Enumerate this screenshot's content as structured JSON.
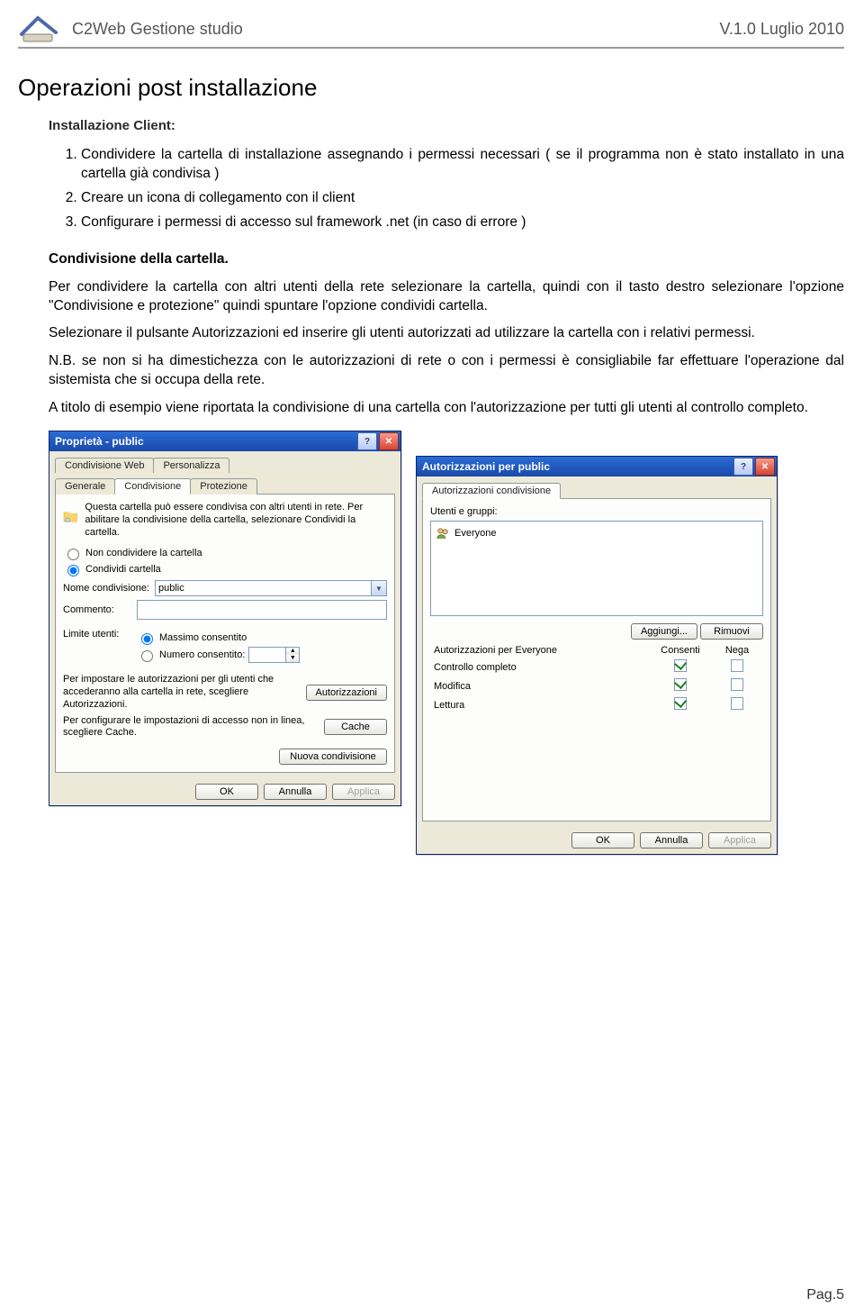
{
  "header": {
    "left": "C2Web Gestione studio",
    "right": "V.1.0 Luglio 2010"
  },
  "title": "Operazioni post installazione",
  "subhead1": "Installazione Client:",
  "steps": [
    "Condividere la cartella di installazione assegnando i permessi necessari ( se il programma non è stato installato in una cartella già condivisa )",
    "Creare un icona di collegamento con il client",
    "Configurare i permessi di accesso sul framework .net (in caso di errore )"
  ],
  "subhead2": "Condivisione della cartella.",
  "paras": [
    "Per condividere la cartella con altri utenti della rete selezionare la cartella, quindi con il tasto destro selezionare l'opzione \"Condivisione e protezione\" quindi spuntare l'opzione condividi cartella.",
    "Selezionare il pulsante Autorizzazioni ed inserire gli utenti autorizzati ad utilizzare la cartella con i relativi permessi.",
    "N.B. se non si ha dimestichezza con le autorizzazioni di rete o con i permessi è consigliabile far effettuare l'operazione dal sistemista che si occupa della rete.",
    "A titolo di esempio viene riportata la condivisione di una cartella con l'autorizzazione per tutti gli utenti al controllo completo."
  ],
  "footer": "Pag.5",
  "dlg1": {
    "title": "Proprietà - public",
    "tabs_row1": [
      "Condivisione Web",
      "Personalizza"
    ],
    "tabs_row2": [
      "Generale",
      "Condivisione",
      "Protezione"
    ],
    "active_tab": "Condivisione",
    "info": "Questa cartella può essere condivisa con altri utenti in rete. Per abilitare la condivisione della cartella, selezionare Condividi la cartella.",
    "radio_noshare": "Non condividere la cartella",
    "radio_share": "Condividi cartella",
    "share_name_label": "Nome condivisione:",
    "share_name_value": "public",
    "comment_label": "Commento:",
    "limit_label": "Limite utenti:",
    "radio_max": "Massimo consentito",
    "radio_num": "Numero consentito:",
    "perm_text": "Per impostare le autorizzazioni per gli utenti che accederanno alla cartella in rete, scegliere Autorizzazioni.",
    "cache_text": "Per configurare le impostazioni di accesso non in linea, scegliere Cache.",
    "btn_auth": "Autorizzazioni",
    "btn_cache": "Cache",
    "btn_newshare": "Nuova condivisione",
    "btn_ok": "OK",
    "btn_cancel": "Annulla",
    "btn_apply": "Applica"
  },
  "dlg2": {
    "title": "Autorizzazioni per public",
    "tab": "Autorizzazioni condivisione",
    "users_label": "Utenti e gruppi:",
    "user": "Everyone",
    "btn_add": "Aggiungi...",
    "btn_remove": "Rimuovi",
    "perm_header": "Autorizzazioni per Everyone",
    "col_allow": "Consenti",
    "col_deny": "Nega",
    "rows": [
      {
        "name": "Controllo completo",
        "allow": true,
        "deny": false
      },
      {
        "name": "Modifica",
        "allow": true,
        "deny": false
      },
      {
        "name": "Lettura",
        "allow": true,
        "deny": false
      }
    ],
    "btn_ok": "OK",
    "btn_cancel": "Annulla",
    "btn_apply": "Applica"
  }
}
